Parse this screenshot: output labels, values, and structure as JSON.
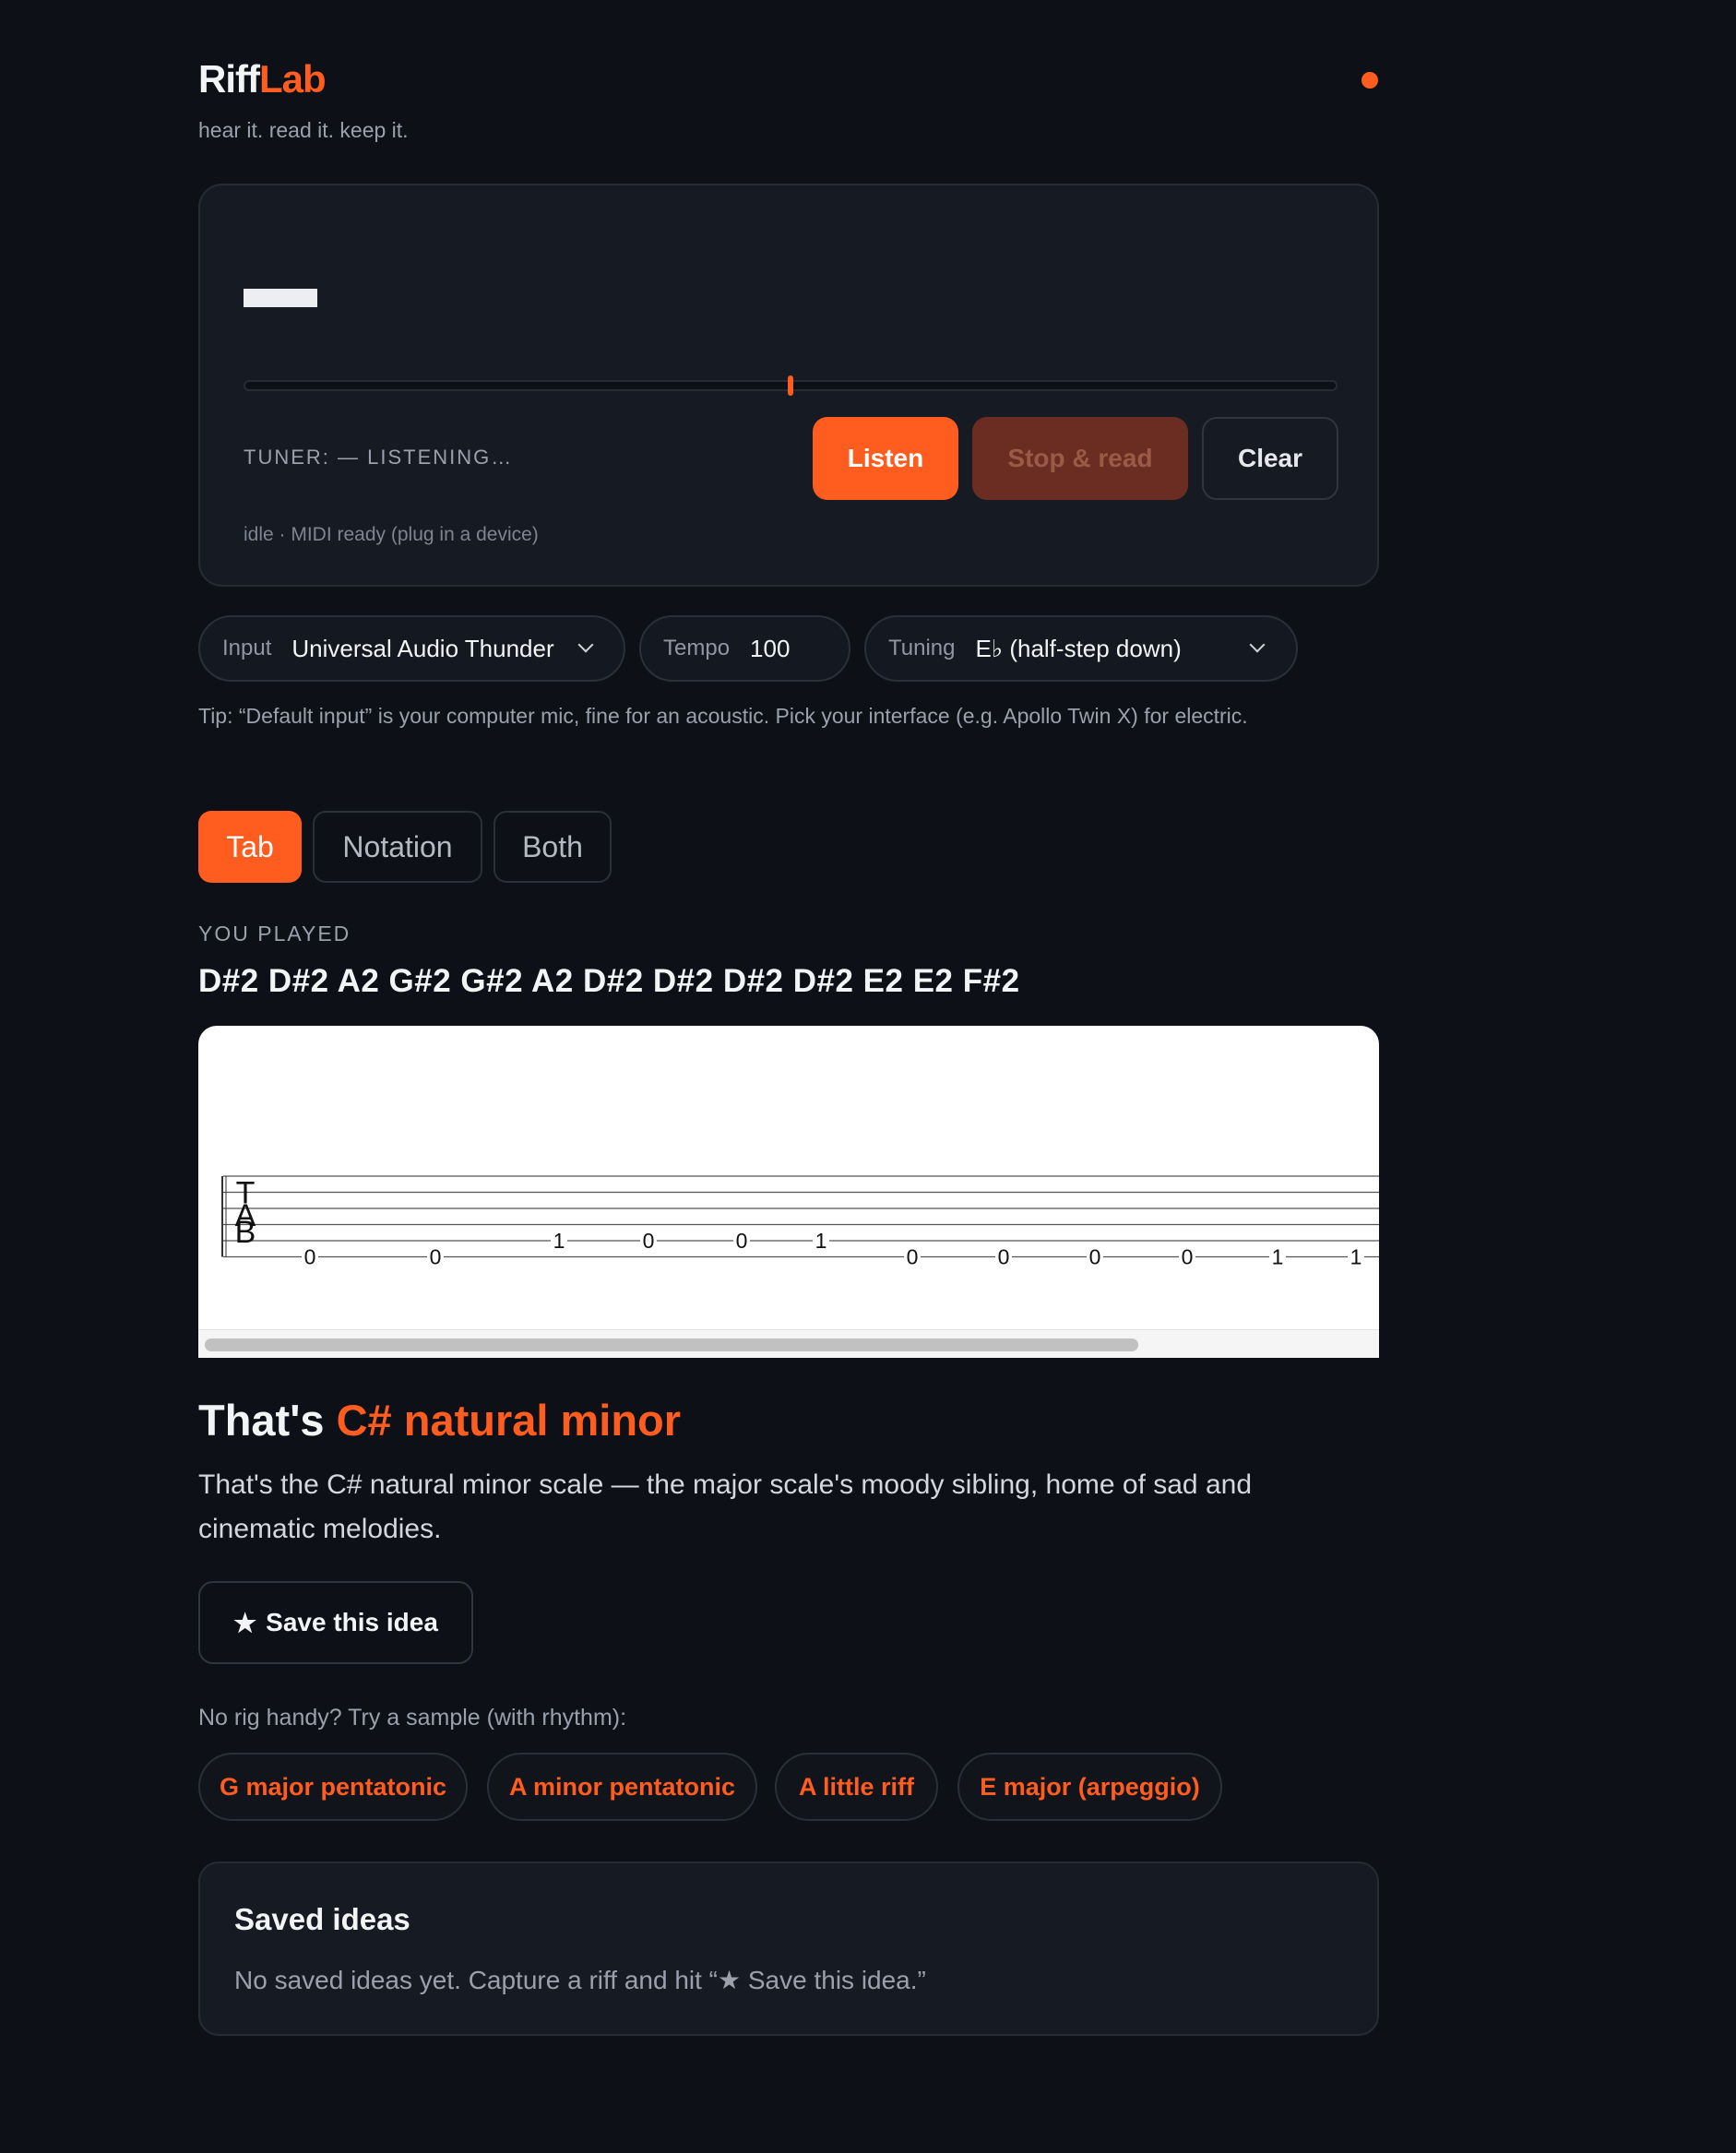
{
  "brand": {
    "name_part1": "Riff",
    "name_part2": "Lab",
    "tagline": "hear it. read it. keep it."
  },
  "capture": {
    "tuner_readout": "TUNER: — LISTENING…",
    "listen_label": "Listen",
    "stop_label": "Stop & read",
    "clear_label": "Clear",
    "status_line": "idle · MIDI ready (plug in a device)",
    "pitch_meter_offset": 0
  },
  "controls": {
    "input": {
      "label": "Input",
      "value": "Universal Audio Thunder"
    },
    "tempo": {
      "label": "Tempo",
      "value": "100"
    },
    "tuning": {
      "label": "Tuning",
      "value": "E♭ (half-step down)"
    },
    "tip": "Tip: “Default input” is your computer mic, fine for an acoustic. Pick your interface (e.g. Apollo Twin X) for electric."
  },
  "view_tabs": {
    "tab": "Tab",
    "notation": "Notation",
    "both": "Both",
    "active": "tab"
  },
  "played": {
    "label": "YOU PLAYED",
    "notes": "D#2 D#2 A2 G#2 G#2 A2 D#2 D#2 D#2 D#2 E2 E2 F#2"
  },
  "tab_staff": {
    "clef": [
      "T",
      "A",
      "B"
    ],
    "notes": [
      {
        "string": 6,
        "fret": "0"
      },
      {
        "string": 6,
        "fret": "0"
      },
      {
        "string": 5,
        "fret": "1"
      },
      {
        "string": 5,
        "fret": "0"
      },
      {
        "string": 5,
        "fret": "0"
      },
      {
        "string": 5,
        "fret": "1"
      },
      {
        "string": 6,
        "fret": "0"
      },
      {
        "string": 6,
        "fret": "0"
      },
      {
        "string": 6,
        "fret": "0"
      },
      {
        "string": 6,
        "fret": "0"
      },
      {
        "string": 6,
        "fret": "1"
      },
      {
        "string": 6,
        "fret": "1"
      }
    ]
  },
  "result": {
    "title_prefix": "That's ",
    "scale_name": "C# natural minor",
    "description": "That's the C# natural minor scale — the major scale's moody sibling, home of sad and cinematic melodies.",
    "save_label": "Save this idea"
  },
  "samples": {
    "label": "No rig handy? Try a sample (with rhythm):",
    "items": [
      "G major pentatonic",
      "A minor pentatonic",
      "A little riff",
      "E major (arpeggio)"
    ]
  },
  "saved": {
    "title": "Saved ideas",
    "empty": "No saved ideas yet. Capture a riff and hit “★ Save this idea.”"
  },
  "colors": {
    "accent": "#ff5c1f",
    "background": "#0d1016",
    "card": "#161a22"
  },
  "icons": {
    "save": "star-icon",
    "dropdown": "chevron-down-icon"
  }
}
